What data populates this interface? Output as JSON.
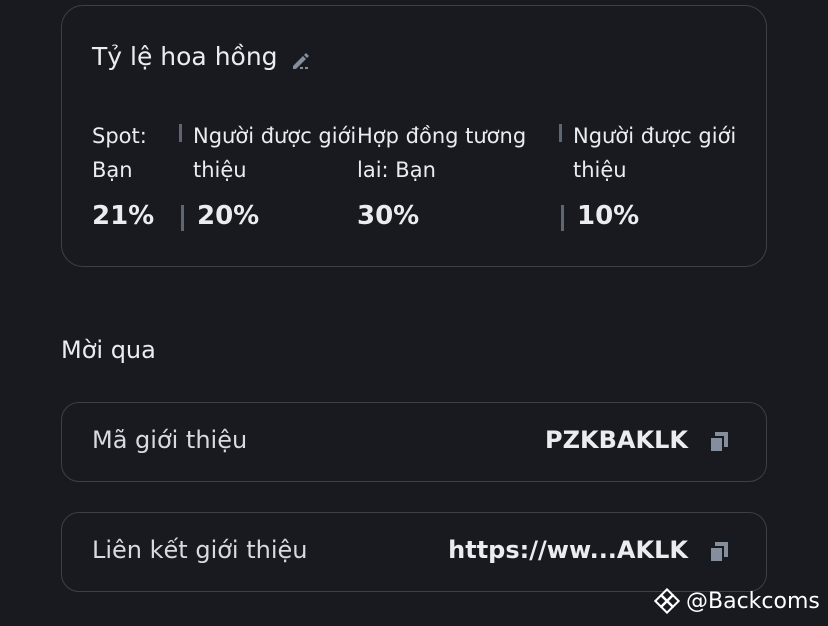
{
  "commission": {
    "title": "Tỷ lệ hoa hồng",
    "edit_icon": "edit-pencil-icon",
    "columns": [
      {
        "label_line1": "Spot:",
        "label_line2": "Bạn",
        "value": "21%"
      },
      {
        "label_line1": "Người được giới",
        "label_line2": "thiệu",
        "value": "20%"
      },
      {
        "label_line1": "Hợp đồng tương",
        "label_line2": "lai: Bạn",
        "value": "30%"
      },
      {
        "label_line1": "Người được giới",
        "label_line2": "thiệu",
        "value": "10%"
      }
    ]
  },
  "invite": {
    "section_title": "Mời qua",
    "referral_code": {
      "label": "Mã giới thiệu",
      "value": "PZKBAKLK",
      "icon": "copy-icon"
    },
    "referral_link": {
      "label": "Liên kết giới thiệu",
      "value": "https://ww...AKLK",
      "icon": "copy-icon"
    }
  },
  "watermark": {
    "text": "@Backcoms",
    "icon": "binance-logo-icon"
  },
  "colors": {
    "background": "#181a20",
    "border": "#3b4049",
    "text_primary": "#eaecef",
    "separator": "#5e6673"
  }
}
